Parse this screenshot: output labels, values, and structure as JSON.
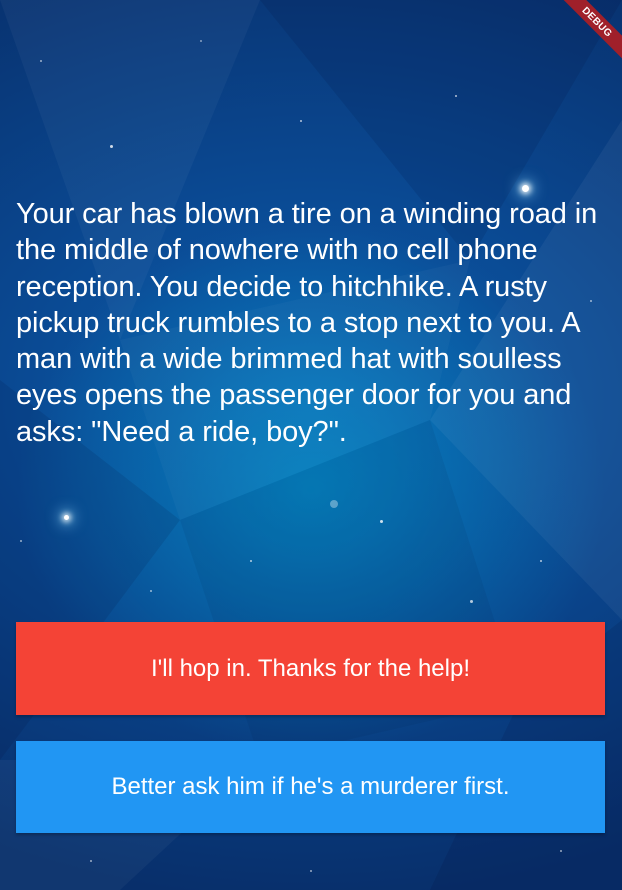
{
  "app": {
    "debug_banner_label": "DEBUG"
  },
  "story": {
    "text": "Your car has blown a tire on a winding road in the middle of nowhere with no cell phone reception. You decide to hitchhike. A rusty pickup truck rumbles to a stop next to you. A man with a wide brimmed hat with soulless eyes opens the passenger door for you and asks: \"Need a ride, boy?\"."
  },
  "choices": [
    {
      "label": "I'll hop in. Thanks for the help!",
      "color": "#f44336"
    },
    {
      "label": "Better ask him if he's a murderer first.",
      "color": "#2196f3"
    }
  ]
}
